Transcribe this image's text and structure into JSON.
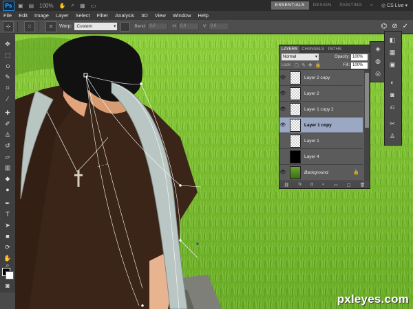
{
  "app_bar": {
    "logo": "Ps",
    "zoom": "100%",
    "workspaces": [
      "ESSENTIALS",
      "DESIGN",
      "PAINTING"
    ],
    "active_workspace": "ESSENTIALS",
    "cs_live": "CS Live"
  },
  "menu": [
    "File",
    "Edit",
    "Image",
    "Layer",
    "Select",
    "Filter",
    "Analysis",
    "3D",
    "View",
    "Window",
    "Help"
  ],
  "options_bar": {
    "warp_label": "Warp:",
    "warp_value": "Custom",
    "fields": [
      {
        "label": "Bend:",
        "value": "0.0"
      },
      {
        "label": "H:",
        "value": "0.0"
      },
      {
        "label": "V:",
        "value": "0.0"
      }
    ]
  },
  "layers_panel": {
    "tabs": [
      "LAYERS",
      "CHANNELS",
      "PATHS"
    ],
    "active_tab": "LAYERS",
    "blend_mode": "Normal",
    "opacity_label": "Opacity:",
    "opacity": "100%",
    "lock_label": "Lock:",
    "fill_label": "Fill:",
    "fill": "100%",
    "layers": [
      {
        "name": "Layer 2 copy",
        "visible": true,
        "thumb": "transparent"
      },
      {
        "name": "Layer 2",
        "visible": true,
        "thumb": "transparent"
      },
      {
        "name": "Layer 1 copy 2",
        "visible": true,
        "thumb": "transparent"
      },
      {
        "name": "Layer 1 copy",
        "visible": true,
        "thumb": "transparent",
        "selected": true
      },
      {
        "name": "Layer 1",
        "visible": false,
        "thumb": "transparent"
      },
      {
        "name": "Layer 4",
        "visible": false,
        "thumb": "black"
      },
      {
        "name": "Background",
        "visible": true,
        "thumb": "photo",
        "locked": true
      }
    ]
  },
  "watermark": "pxleyes.com",
  "colors": {
    "foreground": "#000000",
    "background": "#ffffff",
    "shirt": "#3b2418",
    "grass": "#7ec42c",
    "selected_layer": "#9aa8c3"
  }
}
